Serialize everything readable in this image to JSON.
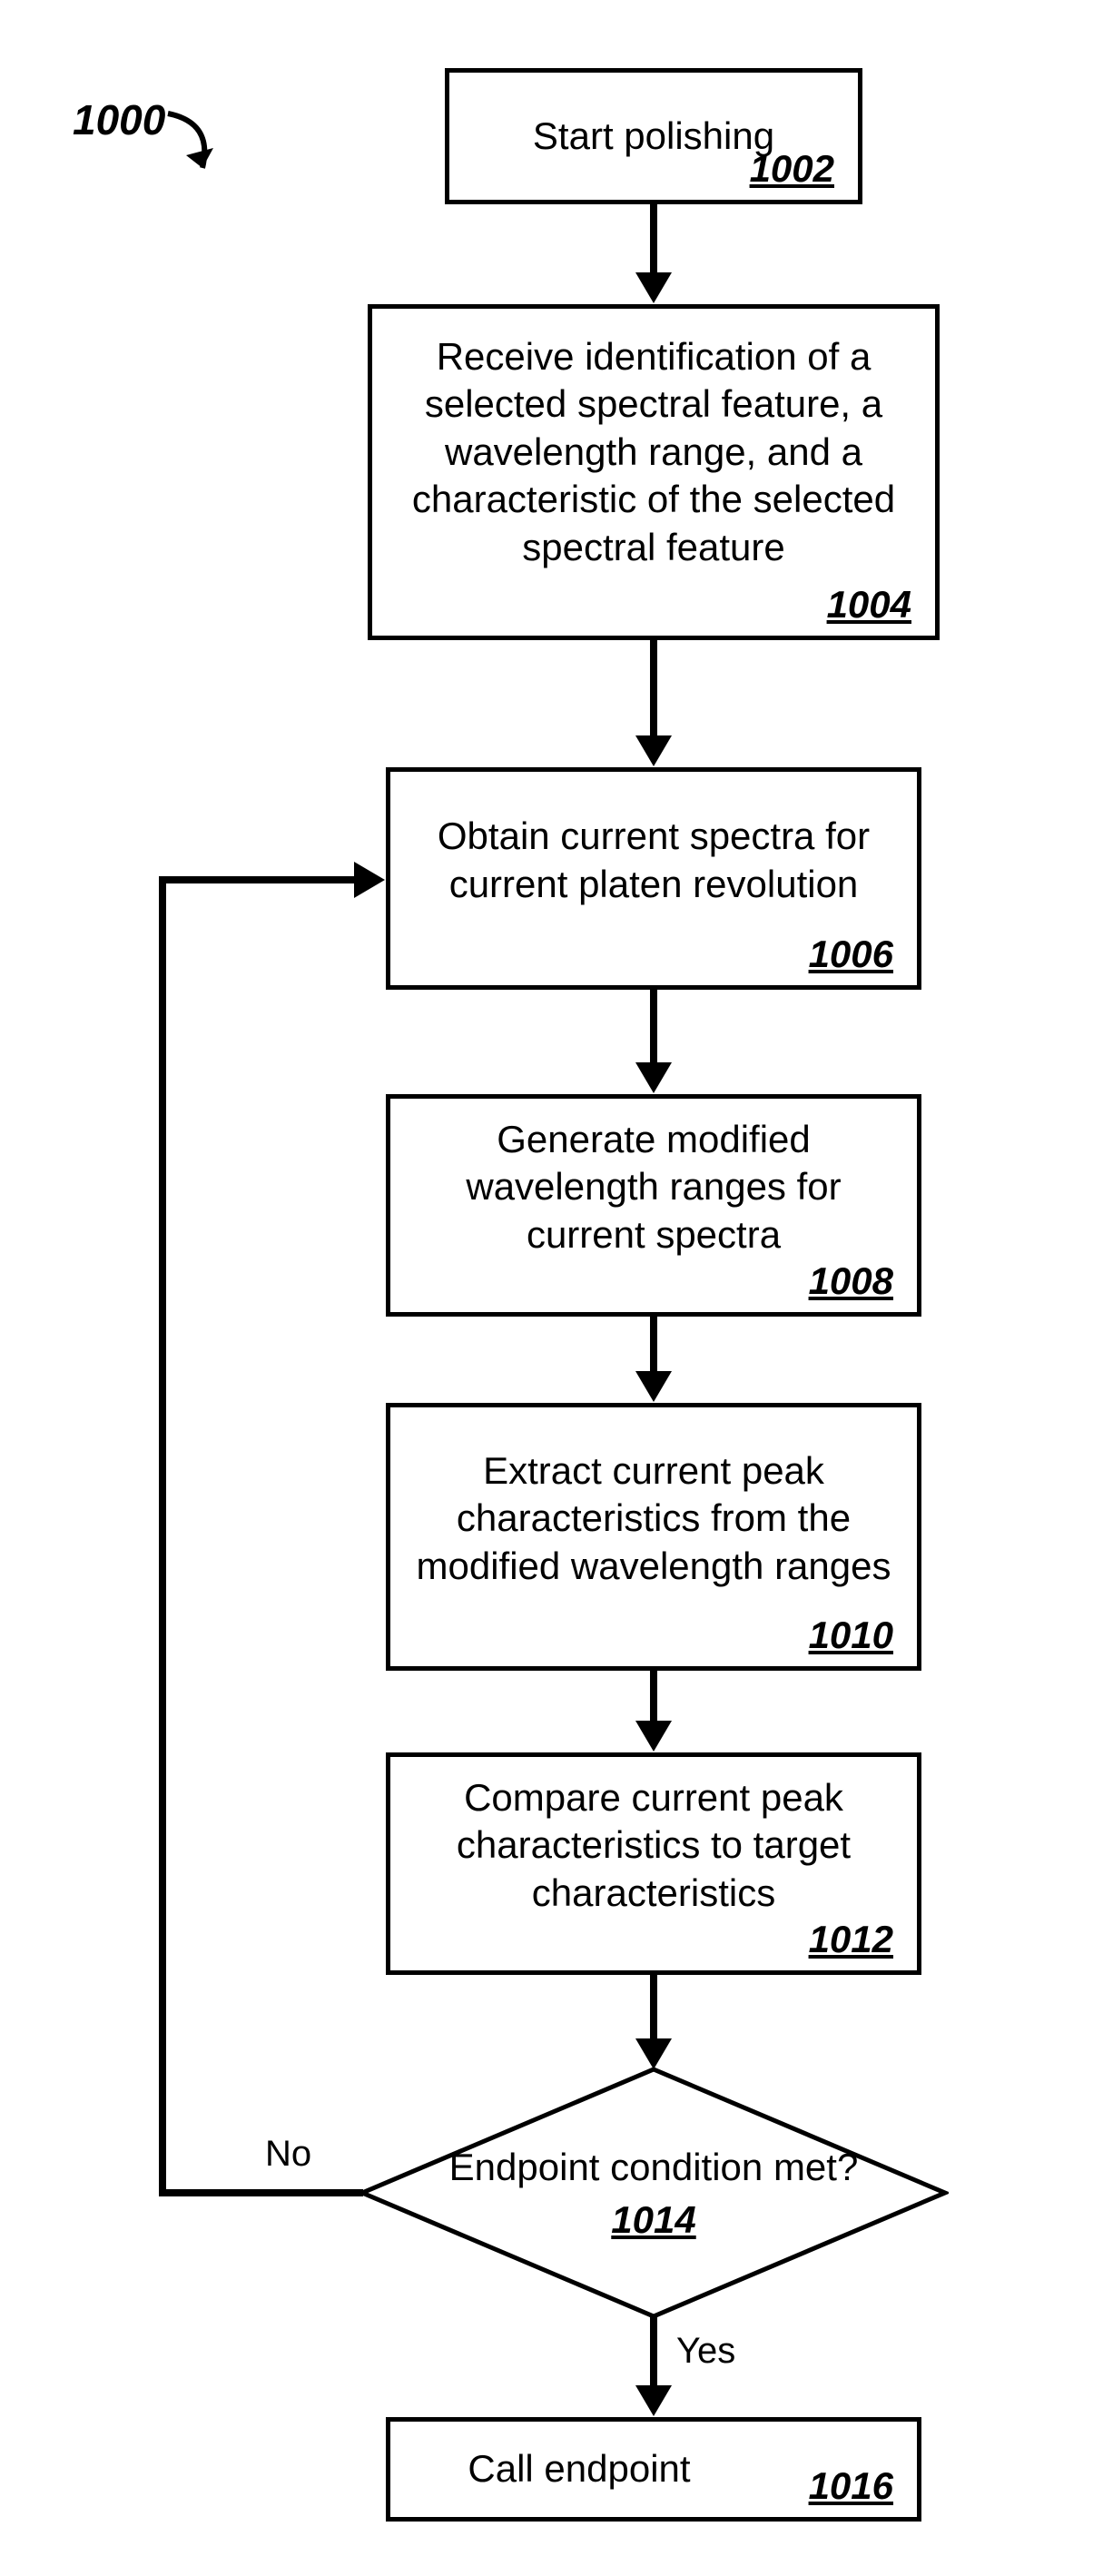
{
  "figure": {
    "label": "1000"
  },
  "nodes": {
    "n1002": {
      "text": "Start polishing",
      "ref": "1002"
    },
    "n1004": {
      "text": "Receive identification of a selected spectral feature, a wavelength range, and a characteristic of the selected spectral feature",
      "ref": "1004"
    },
    "n1006": {
      "text": "Obtain current spectra for current platen revolution",
      "ref": "1006"
    },
    "n1008": {
      "text": "Generate modified wavelength ranges for current spectra",
      "ref": "1008"
    },
    "n1010": {
      "text": "Extract current peak characteristics from the modified wavelength ranges",
      "ref": "1010"
    },
    "n1012": {
      "text": "Compare current peak characteristics to target characteristics",
      "ref": "1012"
    },
    "n1014": {
      "text": "Endpoint condition met?",
      "ref": "1014"
    },
    "n1016": {
      "text": "Call endpoint",
      "ref": "1016"
    }
  },
  "edges": {
    "no": "No",
    "yes": "Yes"
  }
}
